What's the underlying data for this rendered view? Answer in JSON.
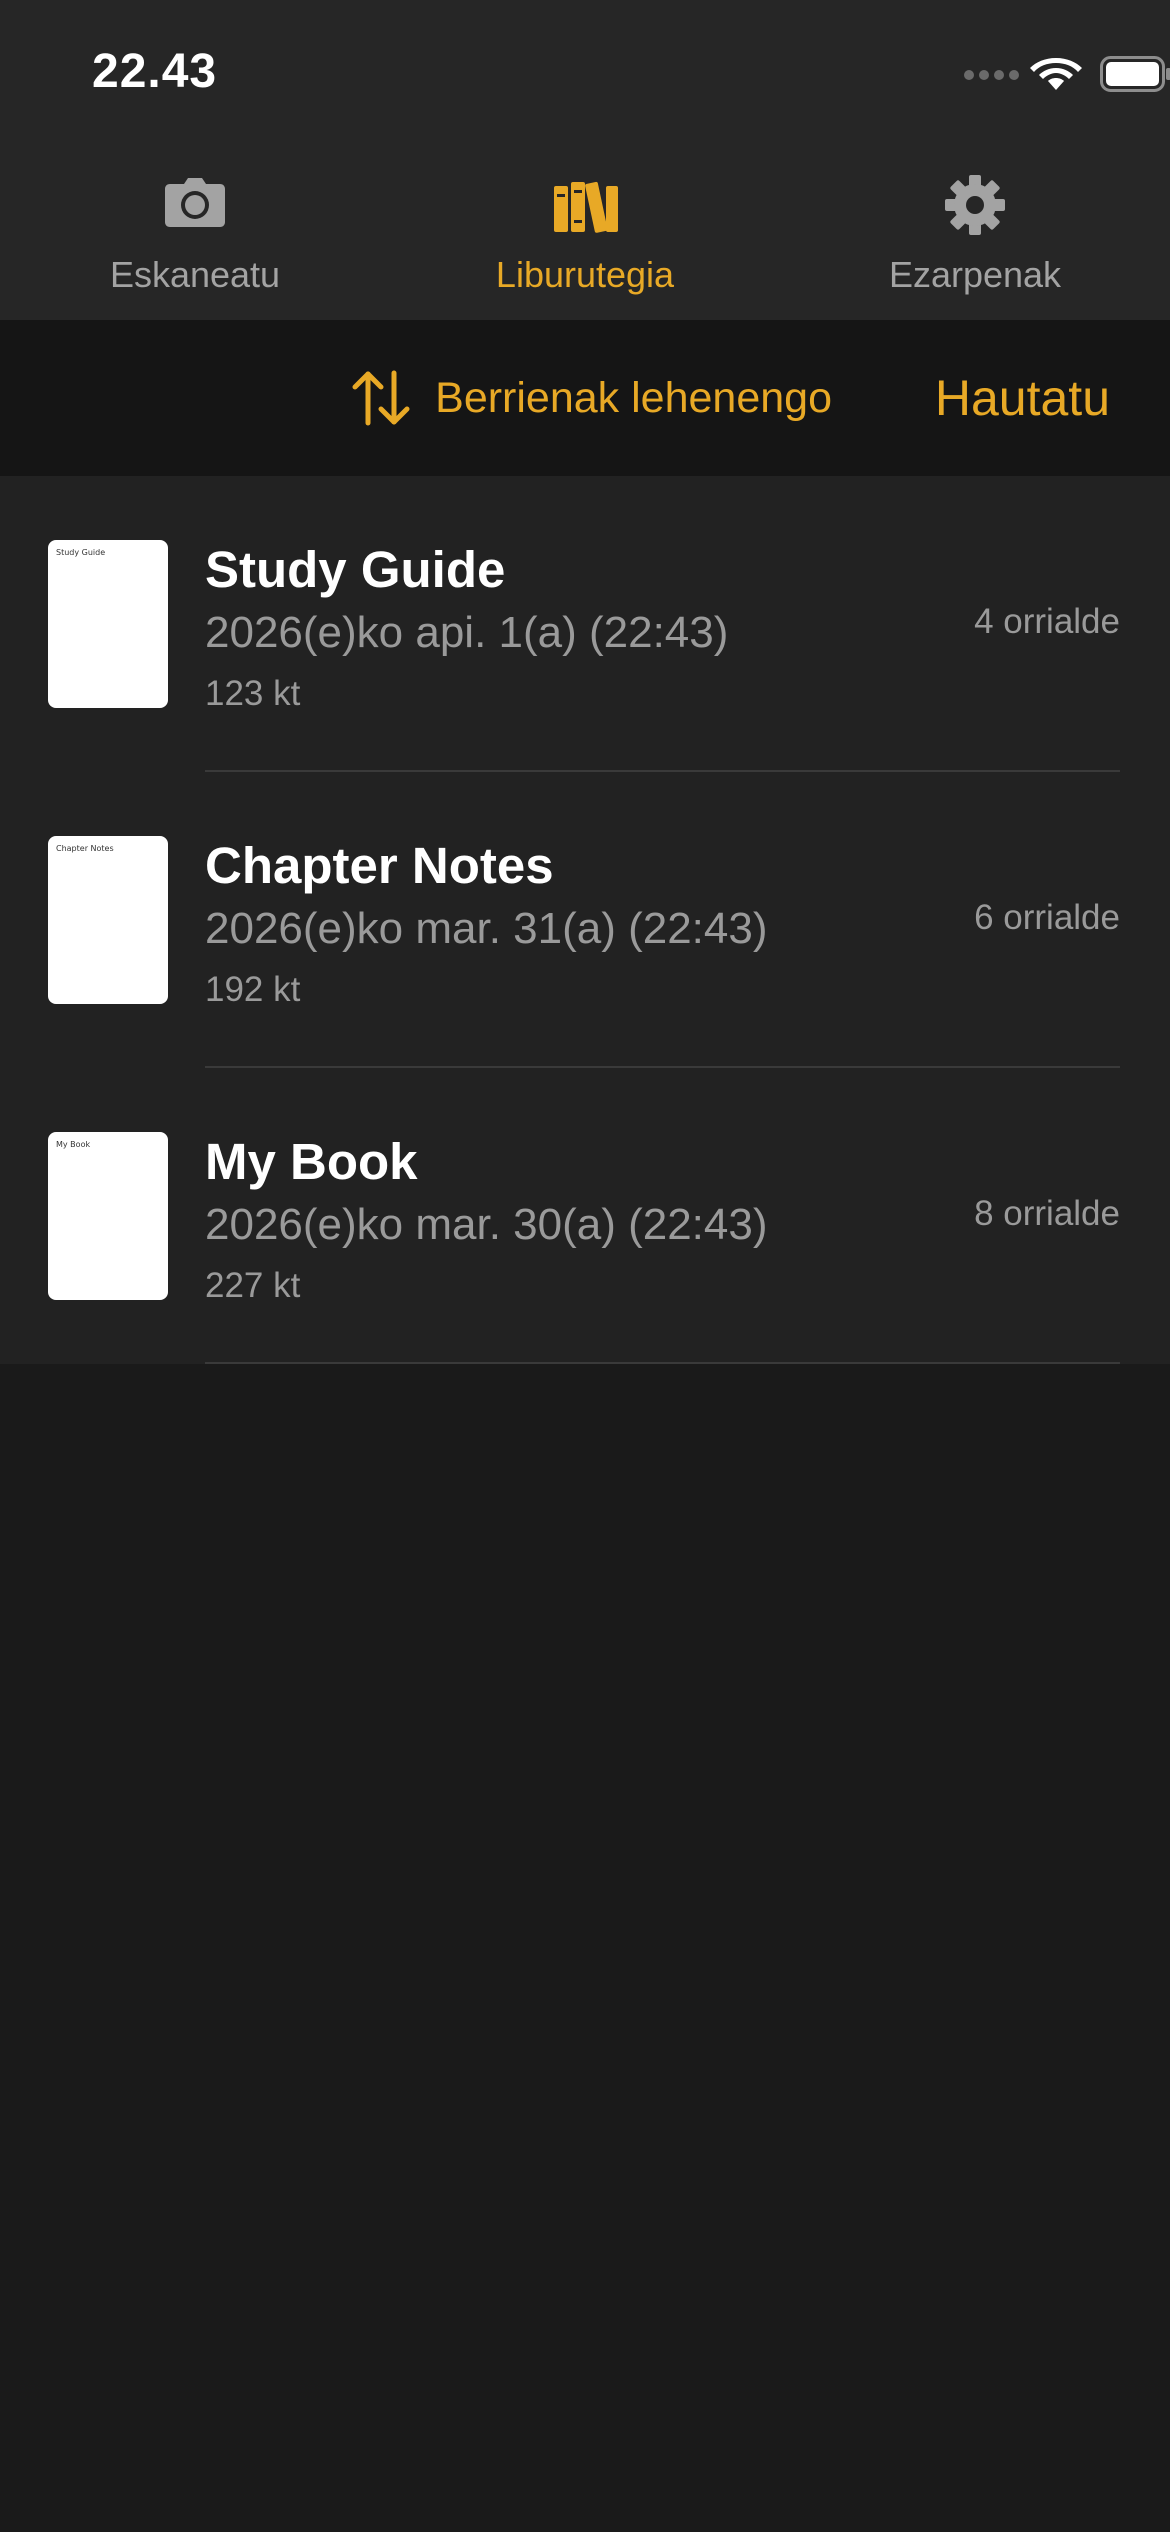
{
  "status_bar": {
    "time": "22.43",
    "icons": [
      "signal-icon",
      "wifi-icon",
      "battery-icon"
    ]
  },
  "tabs": [
    {
      "label": "Eskaneatu",
      "icon": "camera-icon",
      "active": false
    },
    {
      "label": "Liburutegia",
      "icon": "library-books-icon",
      "active": true
    },
    {
      "label": "Ezarpenak",
      "icon": "gear-icon",
      "active": false
    }
  ],
  "toolbar": {
    "sort_label": "Berrienak lehenengo",
    "sort_icon": "sort-arrows-icon",
    "select_label": "Hautatu"
  },
  "documents": [
    {
      "title": "Study Guide",
      "date": "2026(e)ko api. 1(a) (22:43)",
      "size": "123 kt",
      "pages": "4 orrialde"
    },
    {
      "title": "Chapter Notes",
      "date": "2026(e)ko mar. 31(a) (22:43)",
      "size": "192 kt",
      "pages": "6 orrialde"
    },
    {
      "title": "My Book",
      "date": "2026(e)ko mar. 30(a) (22:43)",
      "size": "227 kt",
      "pages": "8 orrialde"
    }
  ],
  "colors": {
    "accent": "#e8a926",
    "background": "#1a1a1a",
    "header_bg": "#262626",
    "toolbar_bg": "#151515",
    "list_bg": "#222222",
    "secondary_text": "#9a9a9a"
  }
}
